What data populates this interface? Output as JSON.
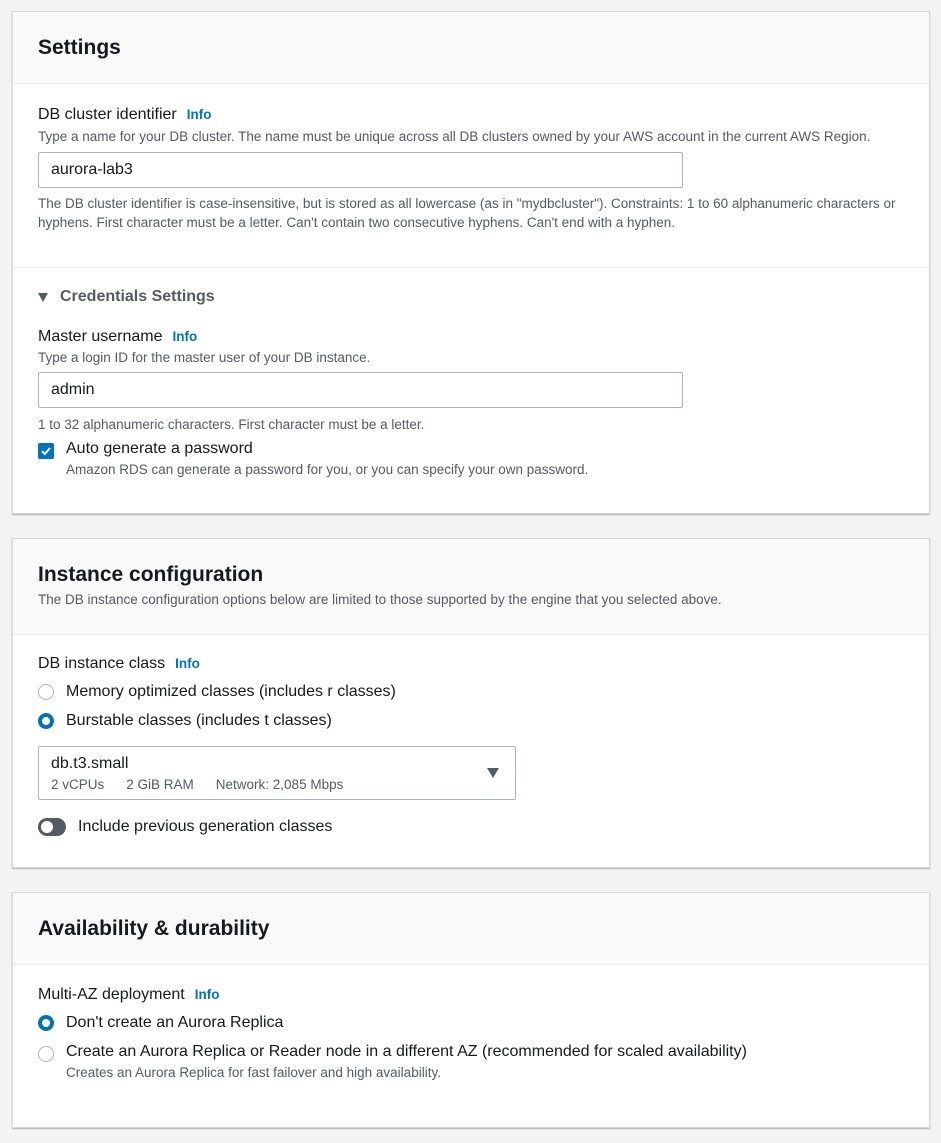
{
  "settings": {
    "title": "Settings",
    "cluster_id": {
      "label": "DB cluster identifier",
      "info": "Info",
      "description": "Type a name for your DB cluster. The name must be unique across all DB clusters owned by your AWS account in the current AWS Region.",
      "value": "aurora-lab3",
      "constraint": "The DB cluster identifier is case-insensitive, but is stored as all lowercase (as in \"mydbcluster\"). Constraints: 1 to 60 alphanumeric characters or hyphens. First character must be a letter. Can't contain two consecutive hyphens. Can't end with a hyphen."
    },
    "credentials": {
      "title": "Credentials Settings",
      "master_username": {
        "label": "Master username",
        "info": "Info",
        "description": "Type a login ID for the master user of your DB instance.",
        "value": "admin",
        "constraint": "1 to 32 alphanumeric characters. First character must be a letter."
      },
      "auto_password": {
        "label": "Auto generate a password",
        "checked": true,
        "description": "Amazon RDS can generate a password for you, or you can specify your own password."
      }
    }
  },
  "instance": {
    "title": "Instance configuration",
    "description": "The DB instance configuration options below are limited to those supported by the engine that you selected above.",
    "class_label": "DB instance class",
    "info": "Info",
    "options": [
      {
        "label": "Memory optimized classes (includes r classes)",
        "selected": false
      },
      {
        "label": "Burstable classes (includes t classes)",
        "selected": true
      }
    ],
    "select": {
      "value": "db.t3.small",
      "vcpus": "2 vCPUs",
      "ram": "2 GiB RAM",
      "network": "Network: 2,085 Mbps"
    },
    "toggle_label": "Include previous generation classes",
    "toggle_on": false
  },
  "availability": {
    "title": "Availability & durability",
    "label": "Multi-AZ deployment",
    "info": "Info",
    "options": [
      {
        "label": "Don't create an Aurora Replica",
        "selected": true,
        "description": ""
      },
      {
        "label": "Create an Aurora Replica or Reader node in a different AZ (recommended for scaled availability)",
        "selected": false,
        "description": "Creates an Aurora Replica for fast failover and high availability."
      }
    ]
  },
  "colors": {
    "accent": "#0073bb",
    "text": "#16191f",
    "secondary_text": "#545b64",
    "border": "#aab7b8",
    "background": "#f2f3f3"
  }
}
